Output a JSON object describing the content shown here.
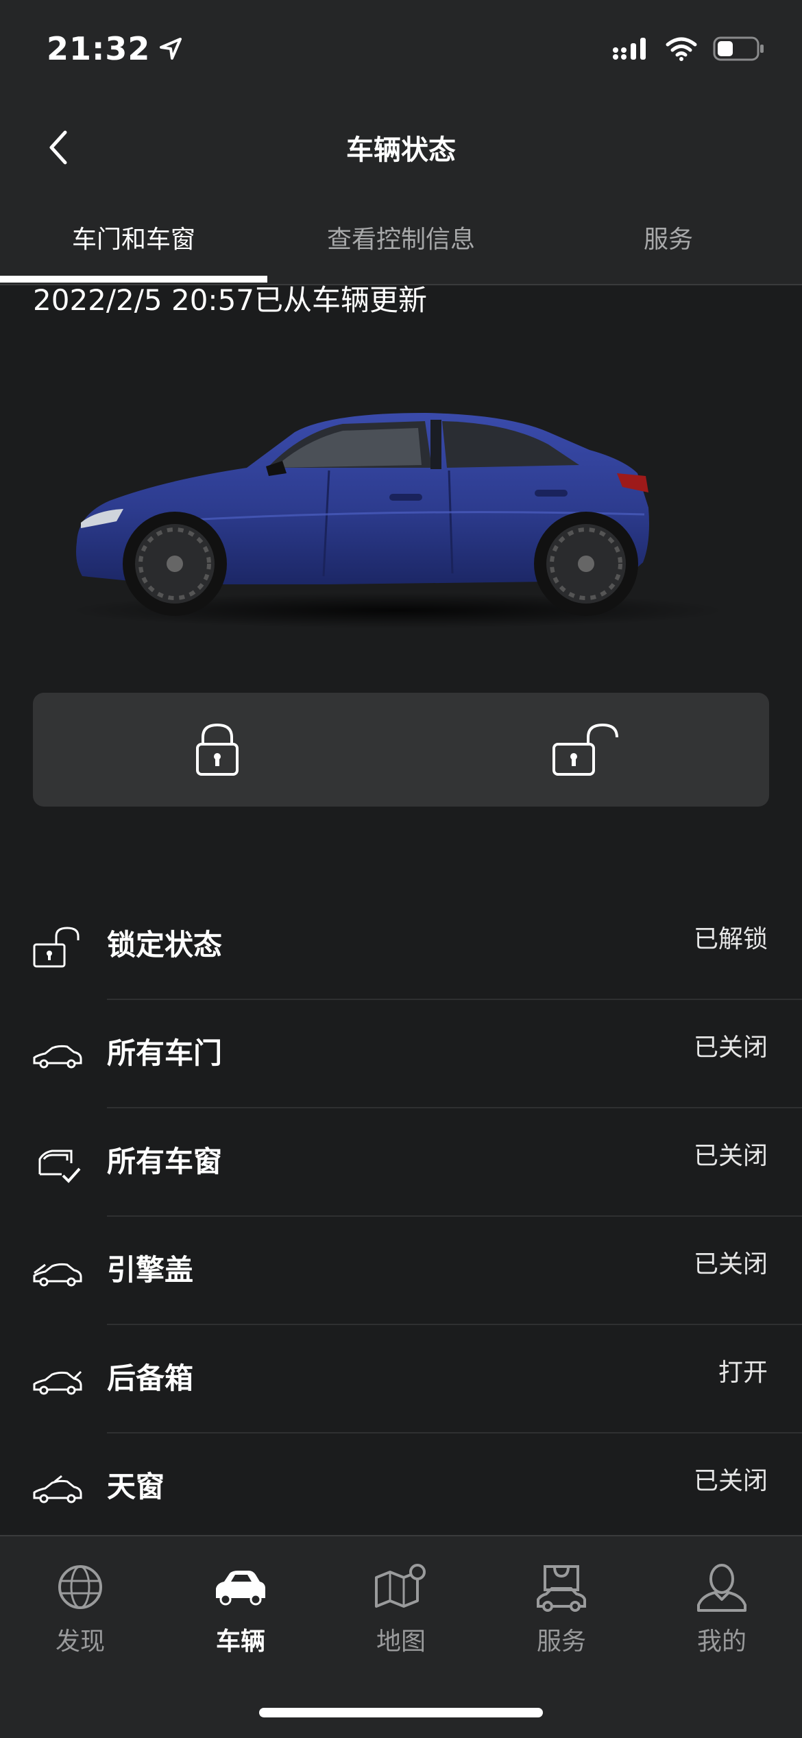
{
  "status_bar": {
    "time": "21:32",
    "battery_level": 0.4
  },
  "header": {
    "title": "车辆状态"
  },
  "tabs": [
    {
      "label": "车门和车窗",
      "active": true
    },
    {
      "label": "查看控制信息",
      "active": false
    },
    {
      "label": "服务",
      "active": false
    }
  ],
  "update_text": "2022/2/5 20:57已从车辆更新",
  "colors": {
    "car_body": "#2d3c8f",
    "background": "#1b1c1d",
    "panel": "#333435"
  },
  "lock_controls": {
    "lock_icon": "padlock-closed-icon",
    "unlock_icon": "padlock-open-icon"
  },
  "status_items": [
    {
      "label": "锁定状态",
      "value": "已解锁",
      "icon": "unlocked-icon"
    },
    {
      "label": "所有车门",
      "value": "已关闭",
      "icon": "car-doors-icon"
    },
    {
      "label": "所有车窗",
      "value": "已关闭",
      "icon": "car-window-icon"
    },
    {
      "label": "引擎盖",
      "value": "已关闭",
      "icon": "car-hood-icon"
    },
    {
      "label": "后备箱",
      "value": "打开",
      "icon": "car-trunk-icon"
    },
    {
      "label": "天窗",
      "value": "已关闭",
      "icon": "car-sunroof-icon"
    }
  ],
  "bottom_nav": [
    {
      "label": "发现",
      "icon": "globe-icon",
      "active": false
    },
    {
      "label": "车辆",
      "icon": "car-icon",
      "active": true
    },
    {
      "label": "地图",
      "icon": "map-icon",
      "active": false
    },
    {
      "label": "服务",
      "icon": "service-icon",
      "active": false
    },
    {
      "label": "我的",
      "icon": "profile-icon",
      "active": false
    }
  ]
}
